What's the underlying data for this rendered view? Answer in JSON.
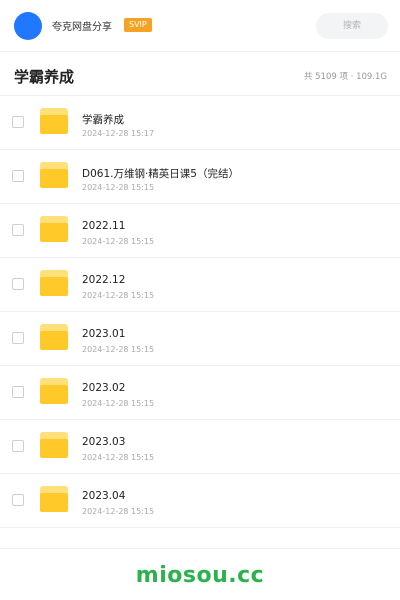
{
  "header": {
    "brand": "夸克网盘分享",
    "badge": "SVIP",
    "search_placeholder": "搜索"
  },
  "folder_title": "学霸养成",
  "summary": "共 5109 项 · 109.1G",
  "items": [
    {
      "name": " 学霸养成",
      "date": "2024-12-28 15:17",
      "icon": "folder-icon"
    },
    {
      "name": "D061.万维钢·精英日课5（完结）",
      "date": "2024-12-28 15:15",
      "icon": "folder-icon"
    },
    {
      "name": "2022.11",
      "date": "2024-12-28 15:15",
      "icon": "folder-icon"
    },
    {
      "name": "2022.12",
      "date": "2024-12-28 15:15",
      "icon": "folder-icon"
    },
    {
      "name": "2023.01",
      "date": "2024-12-28 15:15",
      "icon": "folder-icon"
    },
    {
      "name": "2023.02",
      "date": "2024-12-28 15:15",
      "icon": "folder-icon"
    },
    {
      "name": "2023.03",
      "date": "2024-12-28 15:15",
      "icon": "folder-icon"
    },
    {
      "name": "2023.04",
      "date": "2024-12-28 15:15",
      "icon": "folder-icon"
    }
  ],
  "footer_logo": "miosou.cc",
  "colors": {
    "avatar": "#1f78ff",
    "badge": "#f6a224",
    "folder_body": "#ffc929",
    "folder_tab": "#ffe07a",
    "logo": "#2bb24c"
  }
}
